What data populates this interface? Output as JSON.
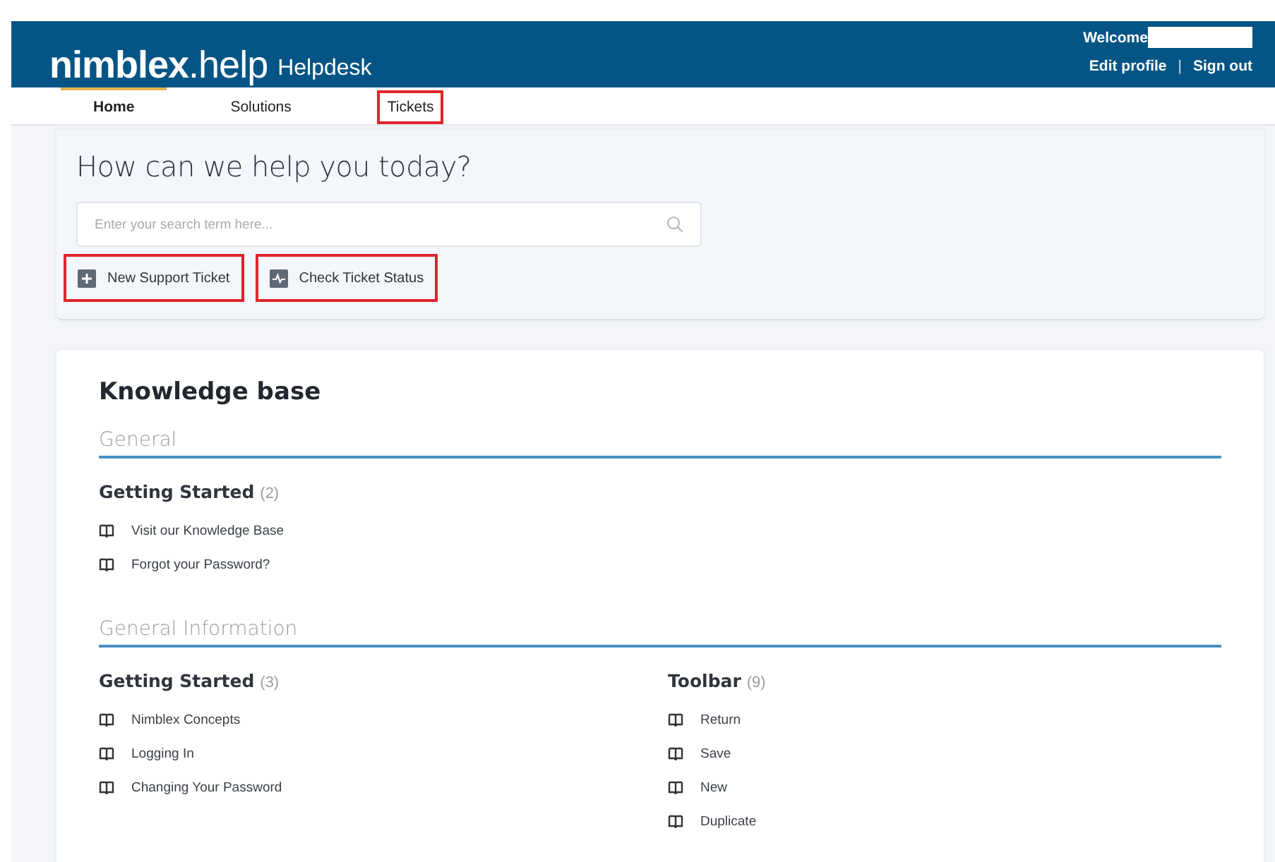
{
  "header": {
    "brand": "nimblex",
    "brand_suffix": ".help",
    "product": "Helpdesk",
    "welcome": "Welcome",
    "name_redacted": true,
    "links": [
      "Edit profile",
      "Sign out"
    ],
    "separator": "|"
  },
  "nav": {
    "tabs": [
      {
        "label": "Home",
        "selected": true,
        "highlighted": false
      },
      {
        "label": "Solutions",
        "selected": false,
        "highlighted": false
      },
      {
        "label": "Tickets",
        "selected": false,
        "highlighted": true
      }
    ]
  },
  "hero": {
    "title": "How can we help you today?",
    "search": {
      "placeholder": "Enter your search term here..."
    },
    "actions": [
      {
        "label": "New Support Ticket",
        "kind": "plus",
        "highlighted": true
      },
      {
        "label": "Check Ticket Status",
        "kind": "pulse",
        "highlighted": true
      }
    ]
  },
  "knowledge_base": {
    "title": "Knowledge base",
    "sections": [
      {
        "name": "General",
        "categories": [
          {
            "title": "Getting Started",
            "count": "(2)",
            "articles": [
              "Visit our Knowledge Base",
              "Forgot your Password?"
            ]
          }
        ]
      },
      {
        "name": "General Information",
        "categories": [
          {
            "title": "Getting Started",
            "count": "(3)",
            "articles": [
              "Nimblex Concepts",
              "Logging In",
              "Changing Your Password"
            ]
          },
          {
            "title": "Toolbar",
            "count": "(9)",
            "articles": [
              "Return",
              "Save",
              "New",
              "Duplicate"
            ]
          }
        ]
      }
    ]
  }
}
